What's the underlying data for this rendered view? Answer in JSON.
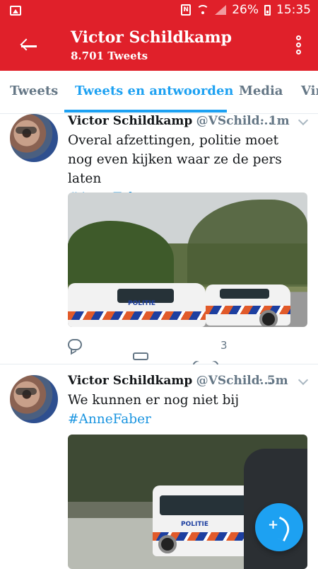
{
  "status_bar": {
    "battery": "26%",
    "time": "15:35"
  },
  "header": {
    "title": "Victor Schildkamp",
    "subtitle": "8.701 Tweets"
  },
  "tabs": [
    {
      "label": "Tweets"
    },
    {
      "label": "Tweets en antwoorden",
      "active": true
    },
    {
      "label": "Media"
    },
    {
      "label": "Vind"
    }
  ],
  "tweets": [
    {
      "name": "Victor Schildkamp",
      "handle": "@VSchild...",
      "time": "· 1m",
      "text": "Overal afzettingen, politie moet nog even kijken waar ze de pers laten",
      "hashtag": "#AnneFaber",
      "like_count": "3"
    },
    {
      "name": "Victor Schildkamp",
      "handle": "@VSchild...",
      "time": "· 5m",
      "text": "We kunnen er nog niet bij",
      "hashtag": "#AnneFaber"
    }
  ],
  "police_label": "POLITIE",
  "colors": {
    "brand_red": "#e0202a",
    "twitter_blue": "#1da1f2",
    "hashtag_blue": "#1b95e0",
    "muted_gray": "#657786"
  }
}
